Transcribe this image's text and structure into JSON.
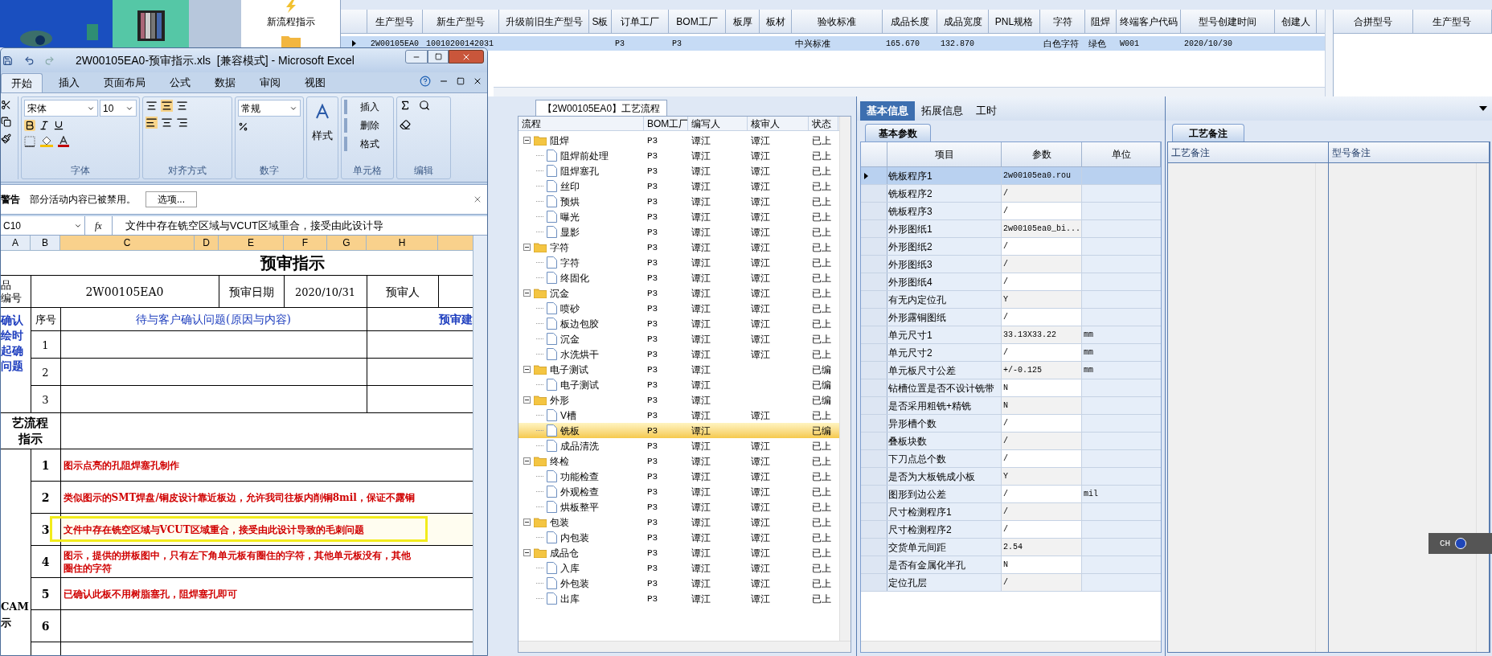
{
  "desktop": {
    "shortcut_label": "新流程指示"
  },
  "model_grid": {
    "columns": [
      "生产型号",
      "新生产型号",
      "升级前旧生产型号",
      "S板",
      "订单工厂",
      "BOM工厂",
      "板厚",
      "板材",
      "验收标准",
      "成品长度",
      "成品宽度",
      "PNL规格",
      "字符",
      "阻焊",
      "终端客户代码",
      "型号创建时间",
      "创建人"
    ],
    "rows": [
      {
        "selected": true,
        "cells": [
          "2W00105EA0",
          "10010200142031",
          "",
          "",
          "P3",
          "P3",
          "",
          "",
          "中兴标准",
          "165.670",
          "132.870",
          "",
          "白色字符",
          "绿色",
          "W001",
          "2020/10/30",
          ""
        ]
      }
    ],
    "side_columns": [
      "合拼型号",
      "生产型号"
    ]
  },
  "flow_panel": {
    "tab": "【2W00105EA0】工艺流程",
    "columns": [
      "流程",
      "BOM工厂",
      "编写人",
      "核审人",
      "状态"
    ],
    "tree": [
      {
        "name": "阻焊",
        "bom": "P3",
        "writer": "谭江",
        "reviewer": "谭江",
        "status": "已上",
        "expanded": true,
        "selected": false,
        "children": [
          {
            "name": "阻焊前处理",
            "bom": "P3",
            "writer": "谭江",
            "reviewer": "谭江",
            "status": "已上",
            "selected": false
          },
          {
            "name": "阻焊塞孔",
            "bom": "P3",
            "writer": "谭江",
            "reviewer": "谭江",
            "status": "已上",
            "selected": false
          },
          {
            "name": "丝印",
            "bom": "P3",
            "writer": "谭江",
            "reviewer": "谭江",
            "status": "已上",
            "selected": false
          },
          {
            "name": "预烘",
            "bom": "P3",
            "writer": "谭江",
            "reviewer": "谭江",
            "status": "已上",
            "selected": false
          },
          {
            "name": "曝光",
            "bom": "P3",
            "writer": "谭江",
            "reviewer": "谭江",
            "status": "已上",
            "selected": false
          },
          {
            "name": "显影",
            "bom": "P3",
            "writer": "谭江",
            "reviewer": "谭江",
            "status": "已上",
            "selected": false
          }
        ]
      },
      {
        "name": "字符",
        "bom": "P3",
        "writer": "谭江",
        "reviewer": "谭江",
        "status": "已上",
        "expanded": true,
        "selected": false,
        "children": [
          {
            "name": "字符",
            "bom": "P3",
            "writer": "谭江",
            "reviewer": "谭江",
            "status": "已上",
            "selected": false
          },
          {
            "name": "终固化",
            "bom": "P3",
            "writer": "谭江",
            "reviewer": "谭江",
            "status": "已上",
            "selected": false
          }
        ]
      },
      {
        "name": "沉金",
        "bom": "P3",
        "writer": "谭江",
        "reviewer": "谭江",
        "status": "已上",
        "expanded": true,
        "selected": false,
        "children": [
          {
            "name": "喷砂",
            "bom": "P3",
            "writer": "谭江",
            "reviewer": "谭江",
            "status": "已上",
            "selected": false
          },
          {
            "name": "板边包胶",
            "bom": "P3",
            "writer": "谭江",
            "reviewer": "谭江",
            "status": "已上",
            "selected": false
          },
          {
            "name": "沉金",
            "bom": "P3",
            "writer": "谭江",
            "reviewer": "谭江",
            "status": "已上",
            "selected": false
          },
          {
            "name": "水洗烘干",
            "bom": "P3",
            "writer": "谭江",
            "reviewer": "谭江",
            "status": "已上",
            "selected": false
          }
        ]
      },
      {
        "name": "电子测试",
        "bom": "P3",
        "writer": "谭江",
        "status": "已编",
        "expanded": true,
        "selected": false,
        "children": [
          {
            "name": "电子测试",
            "bom": "P3",
            "writer": "谭江",
            "status": "已编",
            "selected": false
          }
        ]
      },
      {
        "name": "外形",
        "bom": "P3",
        "writer": "谭江",
        "status": "已编",
        "expanded": true,
        "selected": false,
        "children": [
          {
            "name": "V槽",
            "bom": "P3",
            "writer": "谭江",
            "reviewer": "谭江",
            "status": "已上",
            "selected": false
          },
          {
            "name": "铣板",
            "bom": "P3",
            "writer": "谭江",
            "status": "已编",
            "selected": true
          },
          {
            "name": "成品清洗",
            "bom": "P3",
            "writer": "谭江",
            "reviewer": "谭江",
            "status": "已上",
            "selected": false
          }
        ]
      },
      {
        "name": "终检",
        "bom": "P3",
        "writer": "谭江",
        "reviewer": "谭江",
        "status": "已上",
        "expanded": true,
        "selected": false,
        "children": [
          {
            "name": "功能检查",
            "bom": "P3",
            "writer": "谭江",
            "reviewer": "谭江",
            "status": "已上",
            "selected": false
          },
          {
            "name": "外观检查",
            "bom": "P3",
            "writer": "谭江",
            "reviewer": "谭江",
            "status": "已上",
            "selected": false
          },
          {
            "name": "烘板整平",
            "bom": "P3",
            "writer": "谭江",
            "reviewer": "谭江",
            "status": "已上",
            "selected": false
          }
        ]
      },
      {
        "name": "包装",
        "bom": "P3",
        "writer": "谭江",
        "reviewer": "谭江",
        "status": "已上",
        "expanded": true,
        "selected": false,
        "children": [
          {
            "name": "内包装",
            "bom": "P3",
            "writer": "谭江",
            "reviewer": "谭江",
            "status": "已上",
            "selected": false
          }
        ]
      },
      {
        "name": "成品仓",
        "bom": "P3",
        "writer": "谭江",
        "reviewer": "谭江",
        "status": "已上",
        "expanded": true,
        "selected": false,
        "children": [
          {
            "name": "入库",
            "bom": "P3",
            "writer": "谭江",
            "reviewer": "谭江",
            "status": "已上",
            "selected": false
          },
          {
            "name": "外包装",
            "bom": "P3",
            "writer": "谭江",
            "reviewer": "谭江",
            "status": "已上",
            "selected": false
          },
          {
            "name": "出库",
            "bom": "P3",
            "writer": "谭江",
            "reviewer": "谭江",
            "status": "已上",
            "selected": false
          }
        ]
      }
    ]
  },
  "info_panel": {
    "tabs": [
      {
        "label": "基本信息",
        "selected": true
      },
      {
        "label": "拓展信息",
        "selected": false
      },
      {
        "label": "工时",
        "selected": false
      }
    ],
    "subtab": "基本参数",
    "columns": [
      "项目",
      "参数",
      "单位"
    ],
    "rows": [
      {
        "item": "铣板程序1",
        "value": "2w00105ea0.rou",
        "selected": true
      },
      {
        "item": "铣板程序2",
        "value": "/",
        "selected": false
      },
      {
        "item": "铣板程序3",
        "value": "/",
        "selected": false
      },
      {
        "item": "外形图纸1",
        "value": "2w00105ea0_bi...",
        "selected": false
      },
      {
        "item": "外形图纸2",
        "value": "/",
        "selected": false
      },
      {
        "item": "外形图纸3",
        "value": "/",
        "selected": false
      },
      {
        "item": "外形图纸4",
        "value": "/",
        "selected": false
      },
      {
        "item": "有无内定位孔",
        "value": "Y",
        "selected": false
      },
      {
        "item": "外形露铜图纸",
        "value": "/",
        "selected": false
      },
      {
        "item": "单元尺寸1",
        "value": "33.13X33.22",
        "unit": "mm",
        "selected": false
      },
      {
        "item": "单元尺寸2",
        "value": "/",
        "unit": "mm",
        "selected": false
      },
      {
        "item": "单元板尺寸公差",
        "value": "+/-0.125",
        "unit": "mm",
        "selected": false
      },
      {
        "item": "钻槽位置是否不设计铣带",
        "value": "N",
        "selected": false
      },
      {
        "item": "是否采用粗铣+精铣",
        "value": "N",
        "selected": false
      },
      {
        "item": "异形槽个数",
        "value": "/",
        "selected": false
      },
      {
        "item": "叠板块数",
        "value": "/",
        "selected": false
      },
      {
        "item": "下刀点总个数",
        "value": "/",
        "selected": false
      },
      {
        "item": "是否为大板铣成小板",
        "value": "Y",
        "selected": false
      },
      {
        "item": "图形到边公差",
        "value": "/",
        "unit": "mil",
        "selected": false
      },
      {
        "item": "尺寸检测程序1",
        "value": "/",
        "selected": false
      },
      {
        "item": "尺寸检测程序2",
        "value": "/",
        "selected": false
      },
      {
        "item": "交货单元间距",
        "value": "2.54",
        "selected": false
      },
      {
        "item": "是否有金属化半孔",
        "value": "N",
        "selected": false
      },
      {
        "item": "定位孔层",
        "value": "/",
        "selected": false
      }
    ]
  },
  "notes_panel": {
    "tab": "工艺备注",
    "columns": [
      "工艺备注",
      "型号备注"
    ]
  },
  "ime_bar": {
    "label": "CH"
  },
  "excel": {
    "title": "2W00105EA0-预审指示.xls  [兼容模式] - Microsoft Excel",
    "ribbon_tabs": [
      {
        "label": "开始",
        "selected": true
      },
      {
        "label": "插入",
        "selected": false
      },
      {
        "label": "页面布局",
        "selected": false
      },
      {
        "label": "公式",
        "selected": false
      },
      {
        "label": "数据",
        "selected": false
      },
      {
        "label": "审阅",
        "selected": false
      },
      {
        "label": "视图",
        "selected": false
      }
    ],
    "font_name": "宋体",
    "font_size": "10",
    "number_format": "常规",
    "styles_label": "样式",
    "cell_buttons": [
      "插入",
      "删除",
      "格式"
    ],
    "groups": [
      "字体",
      "对齐方式",
      "数字",
      "单元格",
      "编辑"
    ],
    "security_bar": {
      "title": "警告",
      "message": "部分活动内容已被禁用。",
      "button": "选项..."
    },
    "name_box": "C10",
    "function_label": "fx",
    "formula": "文件中存在铣空区域与VCUT区域重合，接受由此设计导",
    "column_headers": [
      {
        "label": "A",
        "selected": false
      },
      {
        "label": "B",
        "selected": false
      },
      {
        "label": "C",
        "selected": true
      },
      {
        "label": "D",
        "selected": true
      },
      {
        "label": "E",
        "selected": true
      },
      {
        "label": "F",
        "selected": true
      },
      {
        "label": "G",
        "selected": true
      },
      {
        "label": "H",
        "selected": true
      }
    ],
    "sheet": {
      "title": "预审指示",
      "product_label": [
        "品",
        "编号"
      ],
      "product_code": "2W00105EA0",
      "date_label": "预审日期",
      "date": "2020/10/31",
      "reviewer_label": "预审人",
      "number_header": "序号",
      "question_header": "待与客户确认问题(原因与内容)",
      "advice_header": "预审建",
      "confirm_label": [
        "确认",
        "绘时",
        "起确",
        "问题"
      ],
      "confirm_rows": [
        "1",
        "2",
        "3"
      ],
      "flow_label": [
        "艺流程",
        "指示"
      ],
      "cam_label": [
        "CAM",
        "示"
      ],
      "cam_rows": [
        {
          "number": "1",
          "lines": [
            "图示点亮的孔阻焊塞孔制作"
          ],
          "highlighted": false
        },
        {
          "number": "2",
          "lines": [
            "类似图示的SMT焊盘/铜皮设计靠近板边，允许我司往板内削铜8mil，保证不露铜"
          ],
          "highlighted": false
        },
        {
          "number": "3",
          "lines": [
            "文件中存在铣空区域与VCUT区域重合，接受由此设计导致的毛刺问题"
          ],
          "highlighted": true
        },
        {
          "number": "4",
          "lines": [
            "图示，提供的拼板图中，只有左下角单元板有圈住的字符，其他单元板没有，其他",
            "圈住的字符"
          ],
          "highlighted": false
        },
        {
          "number": "5",
          "lines": [
            "已确认此板不用树脂塞孔，阻焊塞孔即可"
          ],
          "highlighted": false
        },
        {
          "number": "6",
          "lines": [],
          "highlighted": false
        }
      ]
    }
  }
}
